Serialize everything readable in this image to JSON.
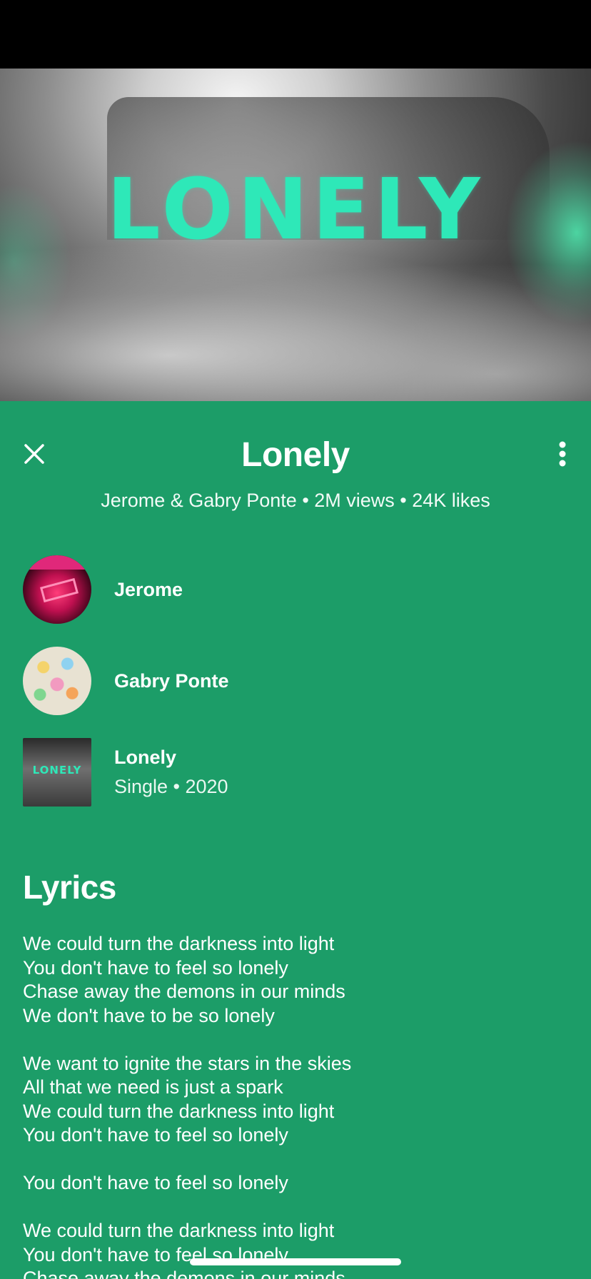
{
  "hero": {
    "artwork_title": "LONELY"
  },
  "header": {
    "title": "Lonely",
    "close_icon": "close-icon",
    "more_icon": "more-vertical-icon"
  },
  "meta_line": "Jerome & Gabry Ponte • 2M views • 24K likes",
  "credits": [
    {
      "name": "Jerome",
      "subtitle": ""
    },
    {
      "name": "Gabry Ponte",
      "subtitle": ""
    },
    {
      "name": "Lonely",
      "subtitle": "Single • 2020",
      "art_text": "LONELY"
    }
  ],
  "lyrics": {
    "heading": "Lyrics",
    "stanzas": [
      [
        "We could turn the darkness into light",
        "You don't have to feel so lonely",
        "Chase away the demons in our minds",
        "We don't have to be so lonely"
      ],
      [
        "We want to ignite the stars in the skies",
        "All that we need is just a spark",
        "We could turn the darkness into light",
        "You don't have to feel so lonely"
      ],
      [
        "You don't have to feel so lonely"
      ],
      [
        "We could turn the darkness into light",
        "You don't have to feel so lonely",
        "Chase away the demons in our minds"
      ]
    ]
  },
  "colors": {
    "background": "#1c9d68",
    "accent": "#2ee8b8",
    "text": "#ffffff"
  }
}
